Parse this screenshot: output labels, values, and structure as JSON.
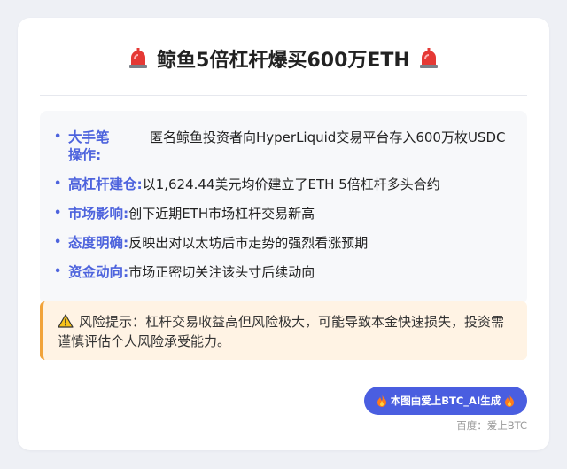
{
  "header": {
    "title": "鲸鱼5倍杠杆爆买600万ETH",
    "left_icon": "siren-icon",
    "right_icon": "siren-icon"
  },
  "highlights": {
    "bullet": "•",
    "items": [
      {
        "label": "大手笔操作:",
        "text": "匿名鲸鱼投资者向HyperLiquid交易平台存入600万枚USDC"
      },
      {
        "label": "高杠杆建仓:",
        "text": "以1,624.44美元均价建立了ETH 5倍杠杆多头合约"
      },
      {
        "label": "市场影响:",
        "text": "创下近期ETH市场杠杆交易新高"
      },
      {
        "label": "态度明确:",
        "text": "反映出对以太坊后市走势的强烈看涨预期"
      },
      {
        "label": "资金动向:",
        "text": "市场正密切关注该头寸后续动向"
      }
    ]
  },
  "risk": {
    "icon": "warning-icon",
    "text": "风险提示：杠杆交易收益高但风险极大，可能导致本金快速损失，投资需谨慎评估个人风险承受能力。"
  },
  "footer": {
    "badge_text": "本图由爱上BTC_AI生成",
    "badge_icon": "fire-icon",
    "credit": "百度：爱上BTC"
  },
  "colors": {
    "accent": "#4d63dd",
    "badge": "#4a5ee0",
    "warning_border": "#f1a33a",
    "warning_bg": "#fff3e4"
  }
}
